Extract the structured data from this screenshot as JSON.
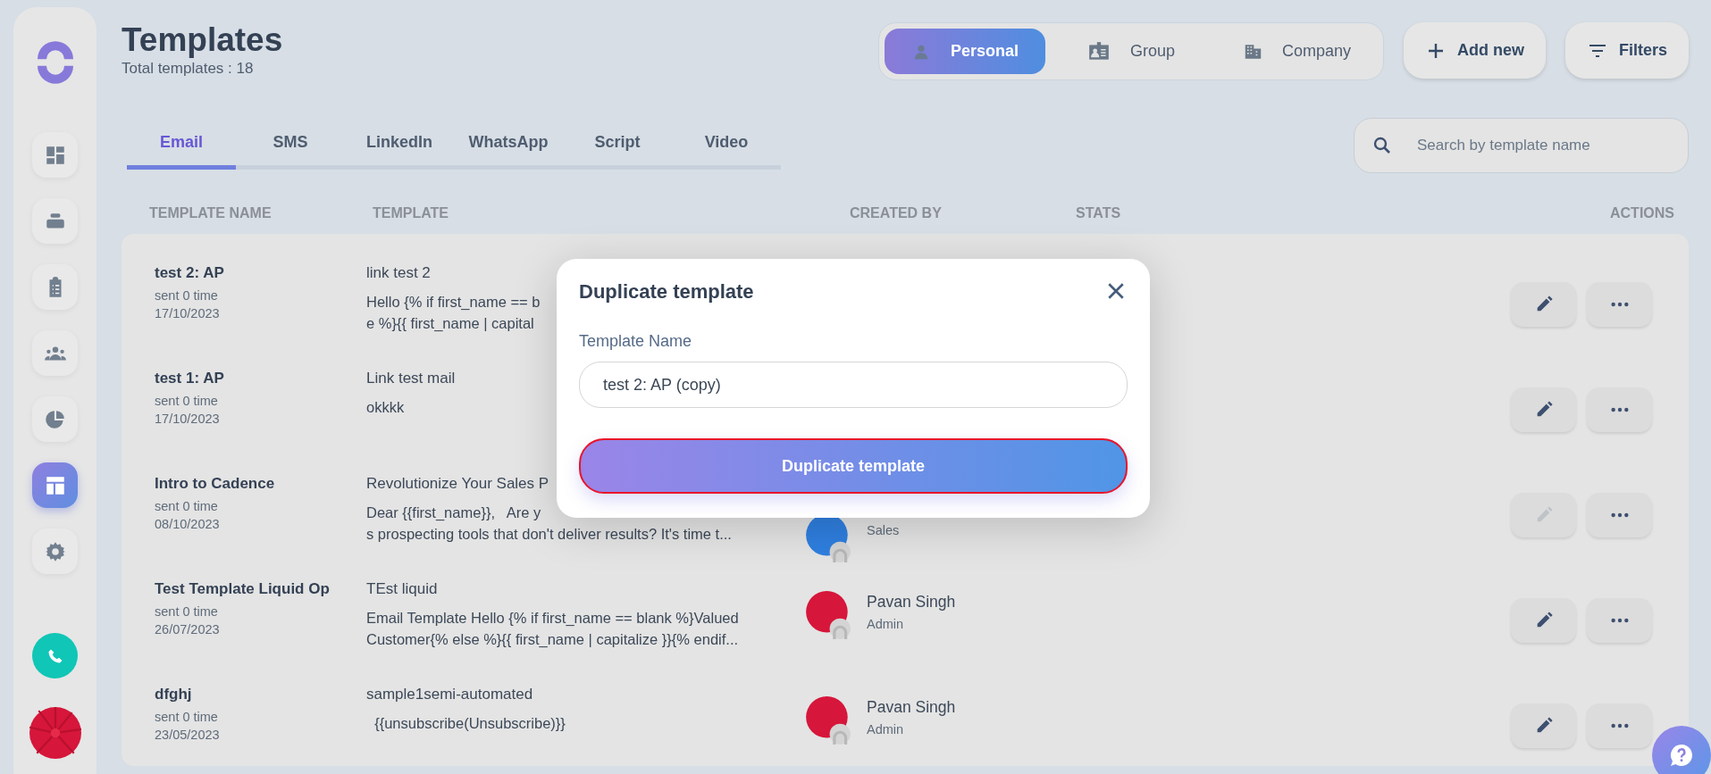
{
  "header": {
    "title": "Templates",
    "subtitle": "Total templates : 18"
  },
  "scope_tabs": [
    {
      "label": "Personal",
      "selected": true
    },
    {
      "label": "Group",
      "selected": false
    },
    {
      "label": "Company",
      "selected": false
    }
  ],
  "actions": [
    "Add new",
    "Filters"
  ],
  "channel_tabs": [
    {
      "label": "Email",
      "selected": true
    },
    {
      "label": "SMS",
      "selected": false
    },
    {
      "label": "LinkedIn",
      "selected": false
    },
    {
      "label": "WhatsApp",
      "selected": false
    },
    {
      "label": "Script",
      "selected": false
    },
    {
      "label": "Video",
      "selected": false
    }
  ],
  "search": {
    "placeholder": "Search by template name"
  },
  "sidebar": {
    "items": [
      {
        "selected": false
      },
      {
        "selected": false
      },
      {
        "selected": false
      },
      {
        "selected": false
      },
      {
        "selected": false
      },
      {
        "selected": true
      },
      {
        "selected": false
      }
    ]
  },
  "table": {
    "columns": [
      "TEMPLATE NAME",
      "TEMPLATE",
      "CREATED BY",
      "STATS",
      "ACTIONS"
    ],
    "rows": [
      {
        "name": "test 2: AP",
        "sent": "sent 0 time",
        "date": "17/10/2023",
        "subject": "link test 2",
        "lines": [
          "Hello {% if first_name == b",
          "e %}{{ first_name | capital"
        ],
        "edit_disabled": false
      },
      {
        "name": "test 1: AP",
        "sent": "sent 0 time",
        "date": "17/10/2023",
        "subject": "Link test mail",
        "lines": [
          "okkkk"
        ],
        "edit_disabled": false
      },
      {
        "name": "Intro to Cadence",
        "sent": "sent 0 time",
        "date": "08/10/2023",
        "subject": "Revolutionize Your Sales P",
        "lines": [
          "Dear {{first_name}},   Are y",
          "s prospecting tools that don't deliver results? It's time t..."
        ],
        "created_by": {
          "role": "Sales",
          "color": "#2f7fe0"
        },
        "edit_disabled": true
      },
      {
        "name": "Test Template Liquid Op",
        "sent": "sent 0 time",
        "date": "26/07/2023",
        "subject": "TEst liquid",
        "lines": [
          "Email Template Hello {% if first_name == blank %}Valued",
          "Customer{% else %}{{ first_name | capitalize }}{% endif..."
        ],
        "created_by": {
          "name": "Pavan Singh",
          "role": "Admin",
          "color": "#d6163a"
        },
        "edit_disabled": false
      },
      {
        "name": "dfghj",
        "sent": "sent 0 time",
        "date": "23/05/2023",
        "subject": "sample1semi-automated",
        "lines": [
          "  {{unsubscribe(Unsubscribe)}}"
        ],
        "created_by": {
          "name": "Pavan Singh",
          "role": "Admin",
          "color": "#d6163a"
        },
        "edit_disabled": false
      }
    ]
  },
  "modal": {
    "title": "Duplicate template",
    "field_label": "Template Name",
    "field_value": "test 2: AP (copy)",
    "submit": "Duplicate template"
  }
}
